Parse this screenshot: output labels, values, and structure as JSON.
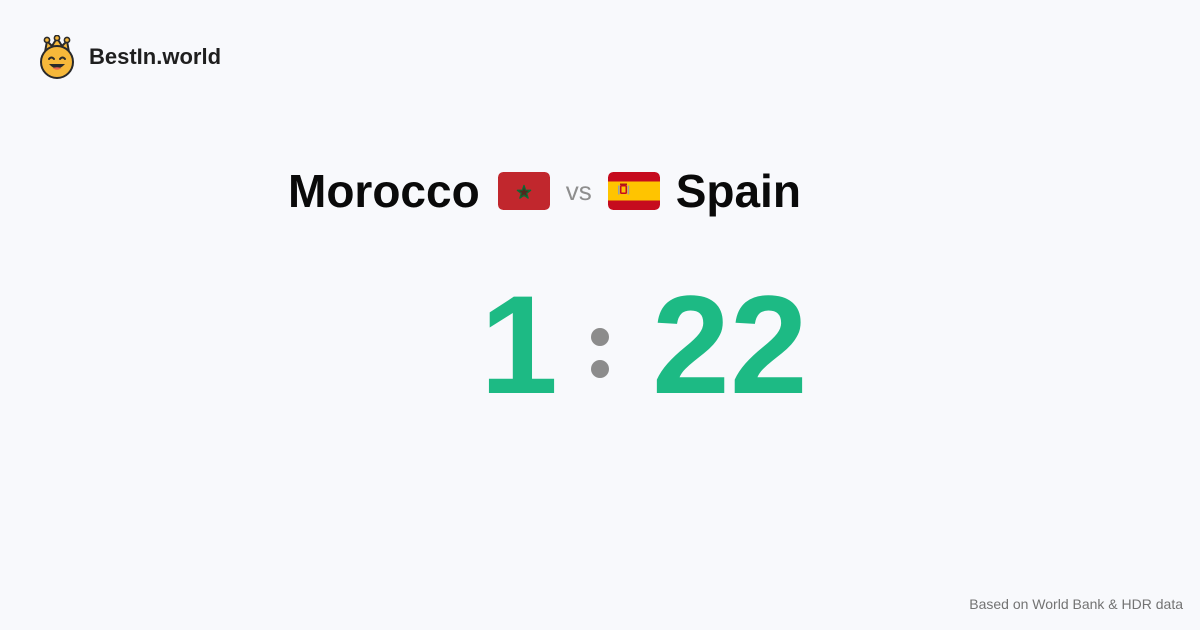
{
  "brand": {
    "name": "BestIn.world",
    "logo_icon": "crown-smiley-logo-icon"
  },
  "comparison": {
    "country_a": "Morocco",
    "flag_a": "morocco-flag-icon",
    "vs_label": "vs",
    "country_b": "Spain",
    "flag_b": "spain-flag-icon"
  },
  "score": {
    "left": "1",
    "right": "22",
    "separator": ":",
    "color": "#1dba84",
    "separator_color": "#8c8c8c"
  },
  "footer": {
    "source_text": "Based on World Bank & HDR data"
  },
  "colors": {
    "background": "#f8f9fc",
    "text": "#0a0a0a",
    "muted": "#8e8e8e"
  }
}
